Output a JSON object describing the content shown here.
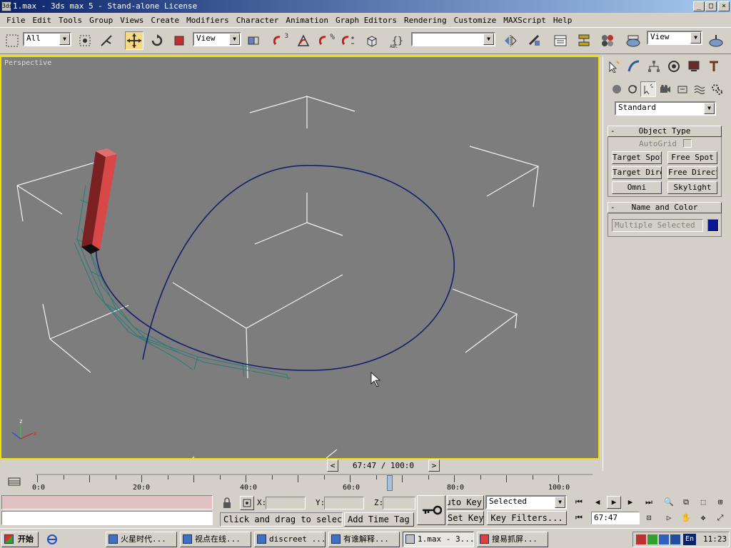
{
  "window": {
    "title": "1.max - 3ds max 5 - Stand-alone License",
    "app_icon": "3ds",
    "min": "_",
    "max": "□",
    "close": "×"
  },
  "menu": [
    "File",
    "Edit",
    "Tools",
    "Group",
    "Views",
    "Create",
    "Modifiers",
    "Character",
    "Animation",
    "Graph Editors",
    "Rendering",
    "Customize",
    "MAXScript",
    "Help"
  ],
  "toolbar": {
    "selection_filter": "All",
    "ref_coord": "View",
    "named_sel": "",
    "render_view": "View",
    "snap_percent": "%",
    "snap_3": "3",
    "abc_label": "ABC"
  },
  "viewport": {
    "label": "Perspective",
    "axis_x": "x",
    "axis_z": "z"
  },
  "command_panel": {
    "category": "Standard",
    "rollouts": {
      "object_type": {
        "title": "Object Type",
        "minus": "-",
        "autogrid": "AutoGrid",
        "buttons": [
          "Target Spot",
          "Free Spot",
          "Target Direct",
          "Free Direct",
          "Omni",
          "Skylight"
        ]
      },
      "name_color": {
        "title": "Name and Color",
        "minus": "-",
        "name_value": "Multiple Selected",
        "color": "#0a1890"
      }
    }
  },
  "timeline": {
    "slider": "67:47 / 100:0",
    "prev": "<",
    "next": ">",
    "ticks": [
      "0:0",
      "20:0",
      "40:0",
      "60:0",
      "80:0",
      "100:0"
    ]
  },
  "status": {
    "coord_x_label": "X:",
    "coord_y_label": "Y:",
    "coord_z_label": "Z:",
    "prompt": "Click and drag to select",
    "add_time_tag": "Add Time Tag",
    "auto_key": "Auto Key",
    "set_key": "Set Key",
    "key_mode": "Selected",
    "key_filters": "Key Filters...",
    "current_frame": "67:47"
  },
  "taskbar": {
    "start": "开始",
    "tasks": [
      "火星时代...",
      "视点在线...",
      "discreet ...",
      "有谁解释...",
      "1.max - 3...",
      "搜易抓屏..."
    ],
    "lang": "En",
    "clock": "11:23"
  }
}
